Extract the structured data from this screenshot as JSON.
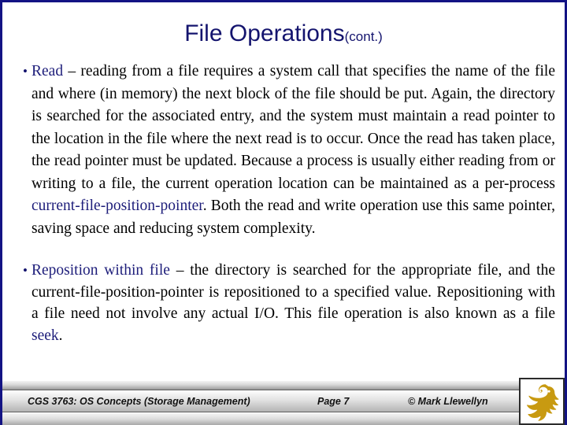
{
  "slide": {
    "title_main": "File Operations",
    "title_suffix": "(cont.)",
    "accent_color": "#14146e",
    "text_color": "#000000",
    "background": "#ffffff",
    "border_color": "#131384"
  },
  "bullets": [
    {
      "marker": "•",
      "keyword": "Read",
      "segments": [
        {
          "text": "Read",
          "style": "accent"
        },
        {
          "text": " – reading from a file requires a system call that specifies the name of the file and where (in memory) the next block of the file should be put.  Again, the directory is searched for the associated entry, and the system must maintain a read pointer to the location in the file where the next read is to occur.  Once the read has taken place, the read pointer must be updated.  Because a process is usually either reading from or writing to a file, the current operation location can be maintained as a per-process ",
          "style": "normal"
        },
        {
          "text": "current-file-position-pointer",
          "style": "accent"
        },
        {
          "text": ".  Both the read and write operation use this same pointer, saving space and reducing system complexity.",
          "style": "normal"
        }
      ]
    },
    {
      "marker": "•",
      "keyword": "Reposition within file",
      "segments": [
        {
          "text": "Reposition within file",
          "style": "accent"
        },
        {
          "text": " – the directory is searched for the appropriate file, and the current-file-position-pointer is repositioned to a specified value.  Repositioning with a file need not involve any actual I/O.  This file operation is also known as a file ",
          "style": "normal"
        },
        {
          "text": "seek",
          "style": "accent"
        },
        {
          "text": ".",
          "style": "normal"
        }
      ]
    }
  ],
  "footer": {
    "course": "CGS 3763: OS Concepts  (Storage Management)",
    "page": "Page 7",
    "copyright": "© Mark Llewellyn",
    "logo_name": "ucf-pegasus-logo",
    "logo_color": "#C89A11"
  }
}
